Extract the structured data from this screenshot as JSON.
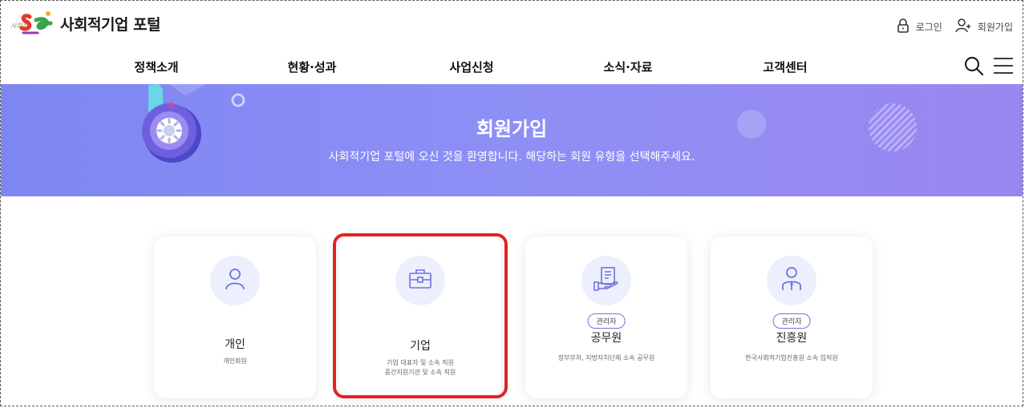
{
  "header": {
    "logo_small": "사회적기업",
    "site_title": "사회적기업 포털",
    "login": "로그인",
    "signup": "회원가입"
  },
  "nav": {
    "items": [
      "정책소개",
      "현황·성과",
      "사업신청",
      "소식·자료",
      "고객센터"
    ]
  },
  "banner": {
    "title": "회원가입",
    "subtitle": "사회적기업 포털에 오신 것을 환영합니다. 해당하는 회원 유형을 선택해주세요."
  },
  "cards": [
    {
      "title": "개인",
      "desc1": "개인회원",
      "desc2": "",
      "badge": "",
      "icon": "person-icon"
    },
    {
      "title": "기업",
      "desc1": "기업 대표자 및 소속 직원",
      "desc2": "중간지원기관 및 소속 직원",
      "badge": "",
      "icon": "briefcase-icon"
    },
    {
      "title": "공무원",
      "desc1": "정부부처, 지방자치단체 소속 공무원",
      "desc2": "",
      "badge": "관리자",
      "icon": "document-hand-icon"
    },
    {
      "title": "진흥원",
      "desc1": "한국사회적기업진흥원 소속 임직원",
      "desc2": "",
      "badge": "관리자",
      "icon": "staff-icon"
    }
  ],
  "colors": {
    "banner_start": "#7e86f2",
    "banner_end": "#9a86f0",
    "accent": "#6e74d8",
    "highlight": "#e32222",
    "icon_bg": "#eceffc"
  }
}
